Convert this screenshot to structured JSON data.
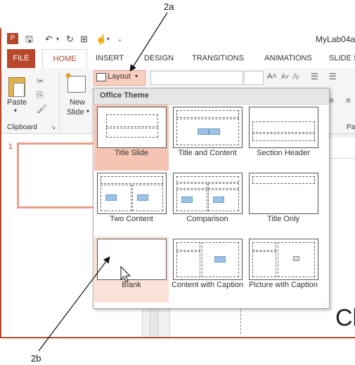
{
  "annotations": {
    "top": "2a",
    "bottom": "2b"
  },
  "window": {
    "title": "MyLab04a."
  },
  "tabs": [
    "FILE",
    "HOME",
    "INSERT",
    "DESIGN",
    "TRANSITIONS",
    "ANIMATIONS",
    "SLIDE S"
  ],
  "ribbon": {
    "paste": "Paste",
    "new": "New",
    "slide": "Slide",
    "layout": "Layout",
    "clipboard": "Clipboard",
    "pa": "Pa"
  },
  "slide_pane": {
    "number": "1"
  },
  "gallery": {
    "header": "Office Theme",
    "items": [
      {
        "label": "Title Slide"
      },
      {
        "label": "Title and Content"
      },
      {
        "label": "Section Header"
      },
      {
        "label": "Two Content"
      },
      {
        "label": "Comparison"
      },
      {
        "label": "Title Only"
      },
      {
        "label": "Blank"
      },
      {
        "label": "Content with Caption"
      },
      {
        "label": "Picture with Caption"
      }
    ]
  },
  "canvas_text": "Cl",
  "colors": {
    "accent": "#b7472a",
    "selected": "#f5c4b3",
    "hover": "#fbe1d8"
  }
}
